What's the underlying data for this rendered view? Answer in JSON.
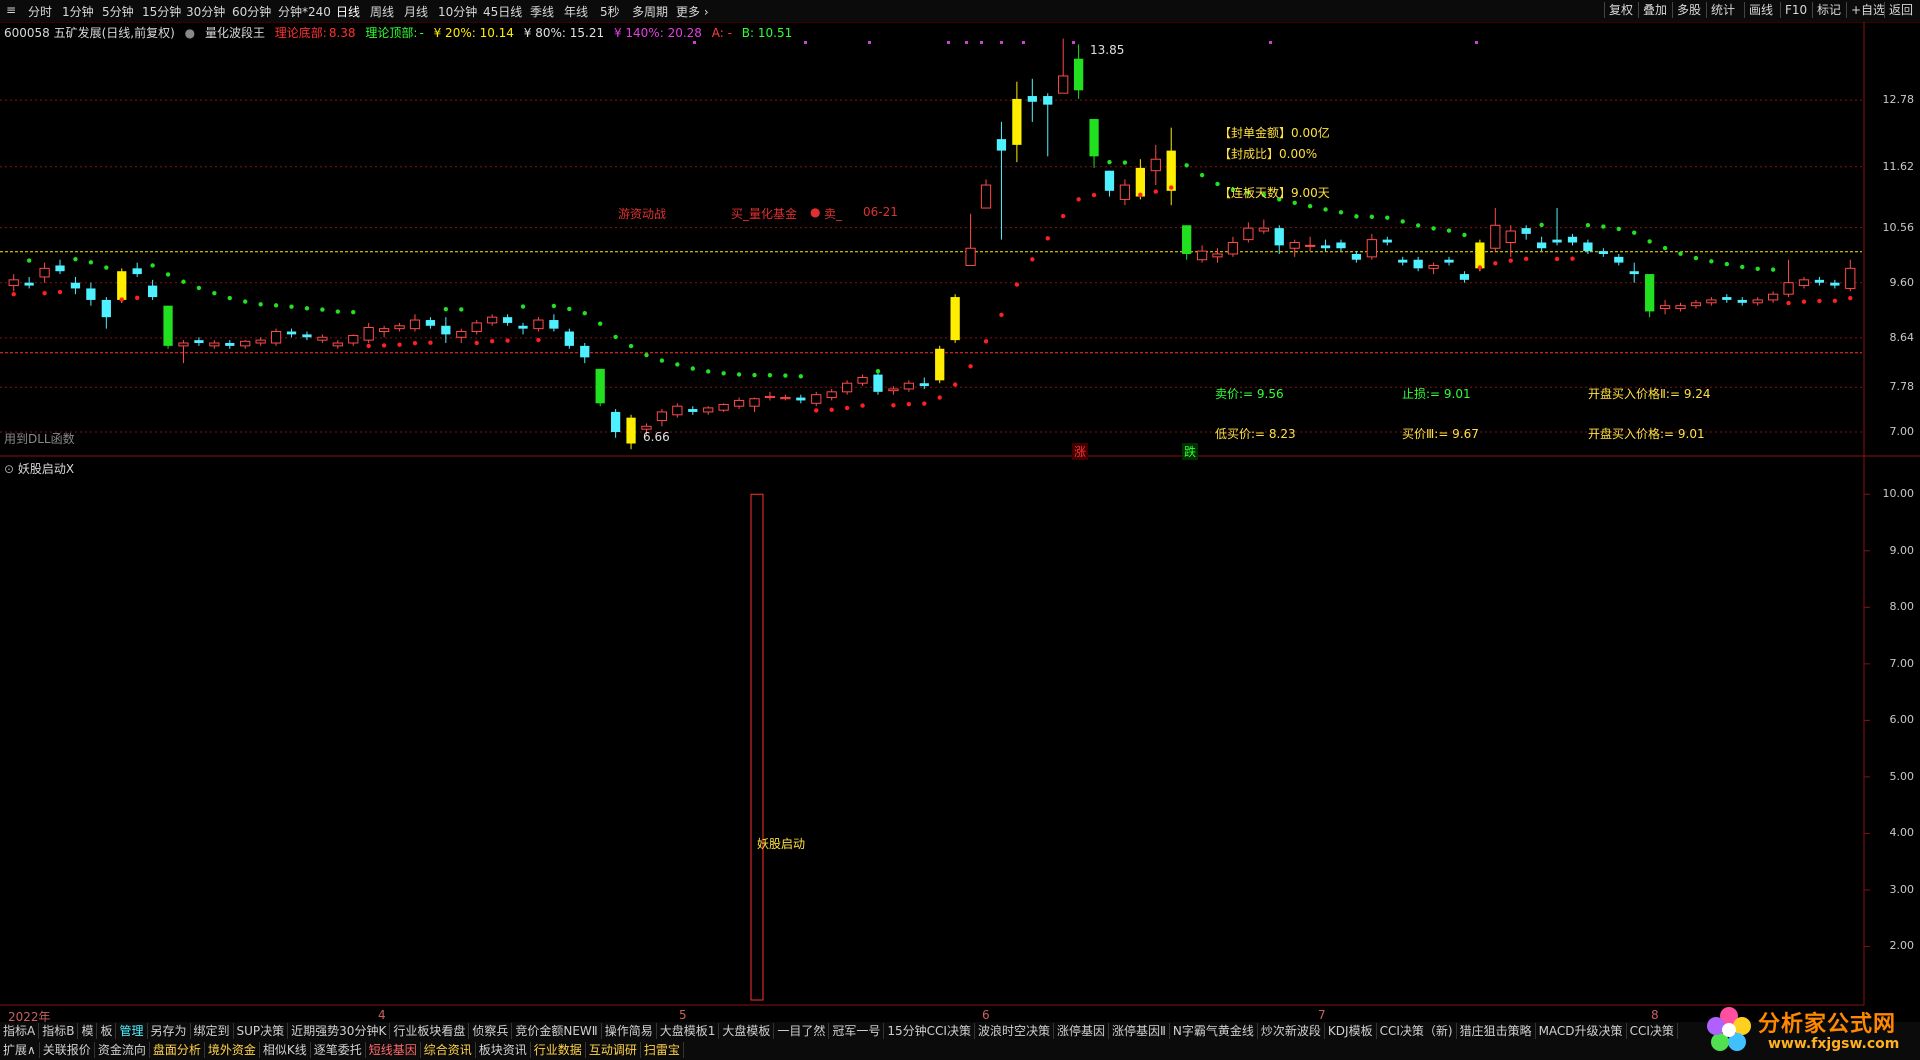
{
  "period_tabs": [
    "分时",
    "1分钟",
    "5分钟",
    "15分钟",
    "30分钟",
    "60分钟",
    "分钟*240",
    "日线",
    "周线",
    "月线",
    "10分钟",
    "45日线",
    "季线",
    "年线",
    "5秒",
    "多周期",
    "更多 ›"
  ],
  "period_active": "日线",
  "right_buttons": [
    "复权",
    "叠加",
    "多股",
    "统计",
    "画线",
    "F10",
    "标记",
    "+自选",
    "返回"
  ],
  "info_line": {
    "stock": "600058 五矿发展(日线,前复权)",
    "indicator": "量化波段王",
    "bottom_label": "理论底部:",
    "bottom_value": "8.38",
    "top_label": "理论顶部:",
    "top_value": "-",
    "y20": "¥ 20%: 10.14",
    "y80": "¥ 80%: 15.21",
    "y140": "¥ 140%: 20.28",
    "a_label": "A: -",
    "b_label": "B: 10.51"
  },
  "colors": {
    "up": "#ff4a4a",
    "down": "#4ff0ff",
    "green_dot": "#22e022",
    "red_dot": "#ff2020",
    "yellow": "#ffee00",
    "magenta": "#d040d0",
    "grid": "#8a1010"
  },
  "annotations": {
    "high_label": "13.85",
    "low_label": "6.66",
    "youzi": "游资动战",
    "buy_text": "买_量化基金",
    "sell_text": "卖_",
    "date_text": "06-21",
    "seal_amount": "【封单金额】0.00亿",
    "seal_ratio": "【封成比】0.00%",
    "limit_days": "【连板天数】9.00天",
    "sell_price": "卖价:= 9.56",
    "stop_loss": "止损:= 9.01",
    "open_buy2": "开盘买入价格Ⅱ:= 9.24",
    "low_buy": "低买价:= 8.23",
    "buy3": "买价Ⅲ:= 9.67",
    "open_buy": "开盘买入价格:= 9.01",
    "dll": "用到DLL函数",
    "zhang": "涨",
    "die": "跌"
  },
  "main_axis": [
    "12.78",
    "11.62",
    "10.56",
    "9.60",
    "8.64",
    "7.78",
    "7.00"
  ],
  "sub_panel": {
    "title": "妖股启动X",
    "bar_label": "妖股启动",
    "axis": [
      "10.00",
      "9.00",
      "8.00",
      "7.00",
      "6.00",
      "5.00",
      "4.00",
      "3.00",
      "2.00"
    ]
  },
  "dates": {
    "year": "2022年",
    "m4": "4",
    "m5": "5",
    "m6": "6",
    "m7": "7",
    "m8": "8"
  },
  "tabs_row1": [
    "指标A",
    "指标B",
    "模",
    "板",
    "管理",
    "另存为",
    "绑定到",
    "SUP决策",
    "近期强势30分钟K",
    "行业板块看盘",
    "侦察兵",
    "竞价金额NEWⅡ",
    "操作简易",
    "大盘模板1",
    "大盘模板",
    "一目了然",
    "冠军一号",
    "15分钟CCI决策",
    "波浪时空决策",
    "涨停基因",
    "涨停基因Ⅱ",
    "N字霸气黄金线",
    "炒次新波段",
    "KDJ模板",
    "CCI决策（新)",
    "猎庄狙击策略",
    "MACD升级决策",
    "CCI决策"
  ],
  "tabs_row2": [
    "扩展∧",
    "关联报价",
    "资金流向",
    "盘面分析",
    "境外资金",
    "相似K线",
    "逐笔委托",
    "短线基因",
    "综合资讯",
    "板块资讯",
    "行业数据",
    "互动调研",
    "扫雷宝"
  ],
  "logo": {
    "name": "分析家公式网",
    "url": "www.fxjgsw.com"
  },
  "chart_data": {
    "type": "candlestick",
    "title": "600058 五矿发展(日线,前复权)",
    "x_labels": [
      "2022年",
      "4",
      "5",
      "6",
      "7",
      "8"
    ],
    "ylim": [
      6.6,
      14.0
    ],
    "candles": [
      {
        "o": 9.55,
        "h": 9.75,
        "l": 9.45,
        "c": 9.65
      },
      {
        "o": 9.6,
        "h": 9.7,
        "l": 9.5,
        "c": 9.55
      },
      {
        "o": 9.7,
        "h": 9.95,
        "l": 9.6,
        "c": 9.85
      },
      {
        "o": 9.9,
        "h": 10.0,
        "l": 9.75,
        "c": 9.8
      },
      {
        "o": 9.6,
        "h": 9.7,
        "l": 9.4,
        "c": 9.5
      },
      {
        "o": 9.5,
        "h": 9.6,
        "l": 9.2,
        "c": 9.3
      },
      {
        "o": 9.3,
        "h": 9.35,
        "l": 8.8,
        "c": 9.0
      },
      {
        "o": 9.3,
        "h": 9.85,
        "l": 9.25,
        "c": 9.8
      },
      {
        "o": 9.85,
        "h": 9.95,
        "l": 9.7,
        "c": 9.75
      },
      {
        "o": 9.55,
        "h": 9.65,
        "l": 9.3,
        "c": 9.35
      },
      {
        "o": 9.2,
        "h": 9.2,
        "l": 8.45,
        "c": 8.5
      },
      {
        "o": 8.5,
        "h": 8.6,
        "l": 8.2,
        "c": 8.55
      },
      {
        "o": 8.6,
        "h": 8.65,
        "l": 8.5,
        "c": 8.55
      },
      {
        "o": 8.5,
        "h": 8.6,
        "l": 8.45,
        "c": 8.55
      },
      {
        "o": 8.55,
        "h": 8.6,
        "l": 8.45,
        "c": 8.5
      },
      {
        "o": 8.5,
        "h": 8.6,
        "l": 8.45,
        "c": 8.58
      },
      {
        "o": 8.55,
        "h": 8.65,
        "l": 8.5,
        "c": 8.6
      },
      {
        "o": 8.55,
        "h": 8.8,
        "l": 8.5,
        "c": 8.75
      },
      {
        "o": 8.75,
        "h": 8.8,
        "l": 8.65,
        "c": 8.7
      },
      {
        "o": 8.7,
        "h": 8.75,
        "l": 8.6,
        "c": 8.65
      },
      {
        "o": 8.6,
        "h": 8.7,
        "l": 8.55,
        "c": 8.65
      },
      {
        "o": 8.5,
        "h": 8.6,
        "l": 8.45,
        "c": 8.55
      },
      {
        "o": 8.55,
        "h": 8.7,
        "l": 8.5,
        "c": 8.68
      },
      {
        "o": 8.6,
        "h": 8.9,
        "l": 8.55,
        "c": 8.82
      },
      {
        "o": 8.75,
        "h": 8.85,
        "l": 8.65,
        "c": 8.8
      },
      {
        "o": 8.8,
        "h": 8.9,
        "l": 8.75,
        "c": 8.85
      },
      {
        "o": 8.8,
        "h": 9.05,
        "l": 8.75,
        "c": 8.95
      },
      {
        "o": 8.95,
        "h": 9.0,
        "l": 8.8,
        "c": 8.85
      },
      {
        "o": 8.85,
        "h": 9.0,
        "l": 8.55,
        "c": 8.7
      },
      {
        "o": 8.65,
        "h": 8.8,
        "l": 8.55,
        "c": 8.75
      },
      {
        "o": 8.75,
        "h": 8.95,
        "l": 8.7,
        "c": 8.9
      },
      {
        "o": 8.9,
        "h": 9.05,
        "l": 8.85,
        "c": 9.0
      },
      {
        "o": 9.0,
        "h": 9.05,
        "l": 8.85,
        "c": 8.9
      },
      {
        "o": 8.85,
        "h": 8.9,
        "l": 8.7,
        "c": 8.8
      },
      {
        "o": 8.8,
        "h": 9.0,
        "l": 8.75,
        "c": 8.95
      },
      {
        "o": 8.95,
        "h": 9.05,
        "l": 8.75,
        "c": 8.8
      },
      {
        "o": 8.75,
        "h": 8.8,
        "l": 8.45,
        "c": 8.5
      },
      {
        "o": 8.5,
        "h": 8.55,
        "l": 8.2,
        "c": 8.3
      },
      {
        "o": 8.1,
        "h": 8.1,
        "l": 7.45,
        "c": 7.5
      },
      {
        "o": 7.35,
        "h": 7.4,
        "l": 6.9,
        "c": 7.0
      },
      {
        "o": 6.8,
        "h": 7.3,
        "l": 6.7,
        "c": 7.25
      },
      {
        "o": 7.05,
        "h": 7.15,
        "l": 6.95,
        "c": 7.1
      },
      {
        "o": 7.2,
        "h": 7.4,
        "l": 7.1,
        "c": 7.35
      },
      {
        "o": 7.3,
        "h": 7.5,
        "l": 7.25,
        "c": 7.45
      },
      {
        "o": 7.4,
        "h": 7.45,
        "l": 7.3,
        "c": 7.35
      },
      {
        "o": 7.35,
        "h": 7.45,
        "l": 7.3,
        "c": 7.42
      },
      {
        "o": 7.38,
        "h": 7.5,
        "l": 7.35,
        "c": 7.48
      },
      {
        "o": 7.45,
        "h": 7.6,
        "l": 7.4,
        "c": 7.55
      },
      {
        "o": 7.45,
        "h": 7.6,
        "l": 7.35,
        "c": 7.58
      },
      {
        "o": 7.6,
        "h": 7.7,
        "l": 7.55,
        "c": 7.62
      },
      {
        "o": 7.58,
        "h": 7.65,
        "l": 7.55,
        "c": 7.6
      },
      {
        "o": 7.6,
        "h": 7.65,
        "l": 7.5,
        "c": 7.55
      },
      {
        "o": 7.5,
        "h": 7.7,
        "l": 7.45,
        "c": 7.65
      },
      {
        "o": 7.6,
        "h": 7.75,
        "l": 7.55,
        "c": 7.7
      },
      {
        "o": 7.7,
        "h": 7.9,
        "l": 7.65,
        "c": 7.85
      },
      {
        "o": 7.85,
        "h": 8.0,
        "l": 7.8,
        "c": 7.95
      },
      {
        "o": 8.0,
        "h": 8.05,
        "l": 7.65,
        "c": 7.7
      },
      {
        "o": 7.72,
        "h": 7.8,
        "l": 7.65,
        "c": 7.75
      },
      {
        "o": 7.75,
        "h": 7.9,
        "l": 7.7,
        "c": 7.85
      },
      {
        "o": 7.85,
        "h": 7.95,
        "l": 7.75,
        "c": 7.8
      },
      {
        "o": 7.9,
        "h": 8.5,
        "l": 7.85,
        "c": 8.45
      },
      {
        "o": 8.6,
        "h": 9.4,
        "l": 8.55,
        "c": 9.35
      },
      {
        "o": 9.9,
        "h": 10.8,
        "l": 9.9,
        "c": 10.2
      },
      {
        "o": 10.9,
        "h": 11.4,
        "l": 10.9,
        "c": 11.3
      },
      {
        "o": 12.1,
        "h": 12.4,
        "l": 10.35,
        "c": 11.9
      },
      {
        "o": 12.0,
        "h": 13.1,
        "l": 11.7,
        "c": 12.8
      },
      {
        "o": 12.85,
        "h": 13.15,
        "l": 12.4,
        "c": 12.75
      },
      {
        "o": 12.85,
        "h": 12.9,
        "l": 11.8,
        "c": 12.7
      },
      {
        "o": 12.9,
        "h": 13.85,
        "l": 12.9,
        "c": 13.2
      },
      {
        "o": 13.5,
        "h": 13.75,
        "l": 12.8,
        "c": 12.95
      },
      {
        "o": 12.45,
        "h": 12.45,
        "l": 11.6,
        "c": 11.8
      },
      {
        "o": 11.55,
        "h": 11.55,
        "l": 11.1,
        "c": 11.2
      },
      {
        "o": 11.05,
        "h": 11.4,
        "l": 10.95,
        "c": 11.3
      },
      {
        "o": 11.1,
        "h": 11.75,
        "l": 11.05,
        "c": 11.6
      },
      {
        "o": 11.55,
        "h": 12.0,
        "l": 11.3,
        "c": 11.75
      },
      {
        "o": 11.2,
        "h": 12.3,
        "l": 10.95,
        "c": 11.9
      },
      {
        "o": 10.6,
        "h": 10.6,
        "l": 10.0,
        "c": 10.1
      },
      {
        "o": 10.0,
        "h": 10.25,
        "l": 9.95,
        "c": 10.15
      },
      {
        "o": 10.05,
        "h": 10.2,
        "l": 9.95,
        "c": 10.1
      },
      {
        "o": 10.1,
        "h": 10.4,
        "l": 10.05,
        "c": 10.3
      },
      {
        "o": 10.35,
        "h": 10.65,
        "l": 10.3,
        "c": 10.55
      },
      {
        "o": 10.5,
        "h": 10.7,
        "l": 10.45,
        "c": 10.55
      },
      {
        "o": 10.55,
        "h": 10.6,
        "l": 10.1,
        "c": 10.25
      },
      {
        "o": 10.2,
        "h": 10.35,
        "l": 10.05,
        "c": 10.3
      },
      {
        "o": 10.25,
        "h": 10.4,
        "l": 10.15,
        "c": 10.25
      },
      {
        "o": 10.25,
        "h": 10.35,
        "l": 10.15,
        "c": 10.2
      },
      {
        "o": 10.3,
        "h": 10.35,
        "l": 10.15,
        "c": 10.2
      },
      {
        "o": 10.1,
        "h": 10.15,
        "l": 9.95,
        "c": 10.0
      },
      {
        "o": 10.05,
        "h": 10.45,
        "l": 10.0,
        "c": 10.35
      },
      {
        "o": 10.35,
        "h": 10.4,
        "l": 10.25,
        "c": 10.3
      },
      {
        "o": 10.0,
        "h": 10.05,
        "l": 9.9,
        "c": 9.95
      },
      {
        "o": 10.0,
        "h": 10.05,
        "l": 9.8,
        "c": 9.85
      },
      {
        "o": 9.85,
        "h": 9.95,
        "l": 9.75,
        "c": 9.9
      },
      {
        "o": 10.0,
        "h": 10.05,
        "l": 9.9,
        "c": 9.95
      },
      {
        "o": 9.75,
        "h": 9.8,
        "l": 9.6,
        "c": 9.65
      },
      {
        "o": 9.85,
        "h": 10.35,
        "l": 9.8,
        "c": 10.3
      },
      {
        "o": 10.2,
        "h": 10.9,
        "l": 10.15,
        "c": 10.6
      },
      {
        "o": 10.3,
        "h": 10.6,
        "l": 10.05,
        "c": 10.5
      },
      {
        "o": 10.55,
        "h": 10.6,
        "l": 10.35,
        "c": 10.45
      },
      {
        "o": 10.3,
        "h": 10.4,
        "l": 10.15,
        "c": 10.2
      },
      {
        "o": 10.35,
        "h": 10.9,
        "l": 10.25,
        "c": 10.3
      },
      {
        "o": 10.4,
        "h": 10.45,
        "l": 10.25,
        "c": 10.3
      },
      {
        "o": 10.3,
        "h": 10.35,
        "l": 10.1,
        "c": 10.15
      },
      {
        "o": 10.15,
        "h": 10.2,
        "l": 10.05,
        "c": 10.1
      },
      {
        "o": 10.05,
        "h": 10.1,
        "l": 9.9,
        "c": 9.95
      },
      {
        "o": 9.8,
        "h": 9.95,
        "l": 9.6,
        "c": 9.75
      },
      {
        "o": 9.75,
        "h": 9.75,
        "l": 9.0,
        "c": 9.1
      },
      {
        "o": 9.15,
        "h": 9.3,
        "l": 9.05,
        "c": 9.2
      },
      {
        "o": 9.15,
        "h": 9.25,
        "l": 9.1,
        "c": 9.2
      },
      {
        "o": 9.2,
        "h": 9.3,
        "l": 9.15,
        "c": 9.25
      },
      {
        "o": 9.25,
        "h": 9.35,
        "l": 9.2,
        "c": 9.3
      },
      {
        "o": 9.35,
        "h": 9.4,
        "l": 9.25,
        "c": 9.3
      },
      {
        "o": 9.3,
        "h": 9.35,
        "l": 9.2,
        "c": 9.25
      },
      {
        "o": 9.25,
        "h": 9.35,
        "l": 9.2,
        "c": 9.3
      },
      {
        "o": 9.3,
        "h": 9.45,
        "l": 9.25,
        "c": 9.4
      },
      {
        "o": 9.4,
        "h": 10.0,
        "l": 9.35,
        "c": 9.6
      },
      {
        "o": 9.55,
        "h": 9.7,
        "l": 9.5,
        "c": 9.65
      },
      {
        "o": 9.65,
        "h": 9.7,
        "l": 9.55,
        "c": 9.6
      },
      {
        "o": 9.6,
        "h": 9.65,
        "l": 9.5,
        "c": 9.55
      },
      {
        "o": 9.5,
        "h": 10.0,
        "l": 9.45,
        "c": 9.85
      }
    ],
    "reference_lines": {
      "yellow_dashed": 10.14,
      "red_dashed": 8.38
    },
    "sub_indicator": {
      "name": "妖股启动X",
      "bar_value": 10.0,
      "ylim": [
        1.0,
        10.5
      ]
    }
  }
}
